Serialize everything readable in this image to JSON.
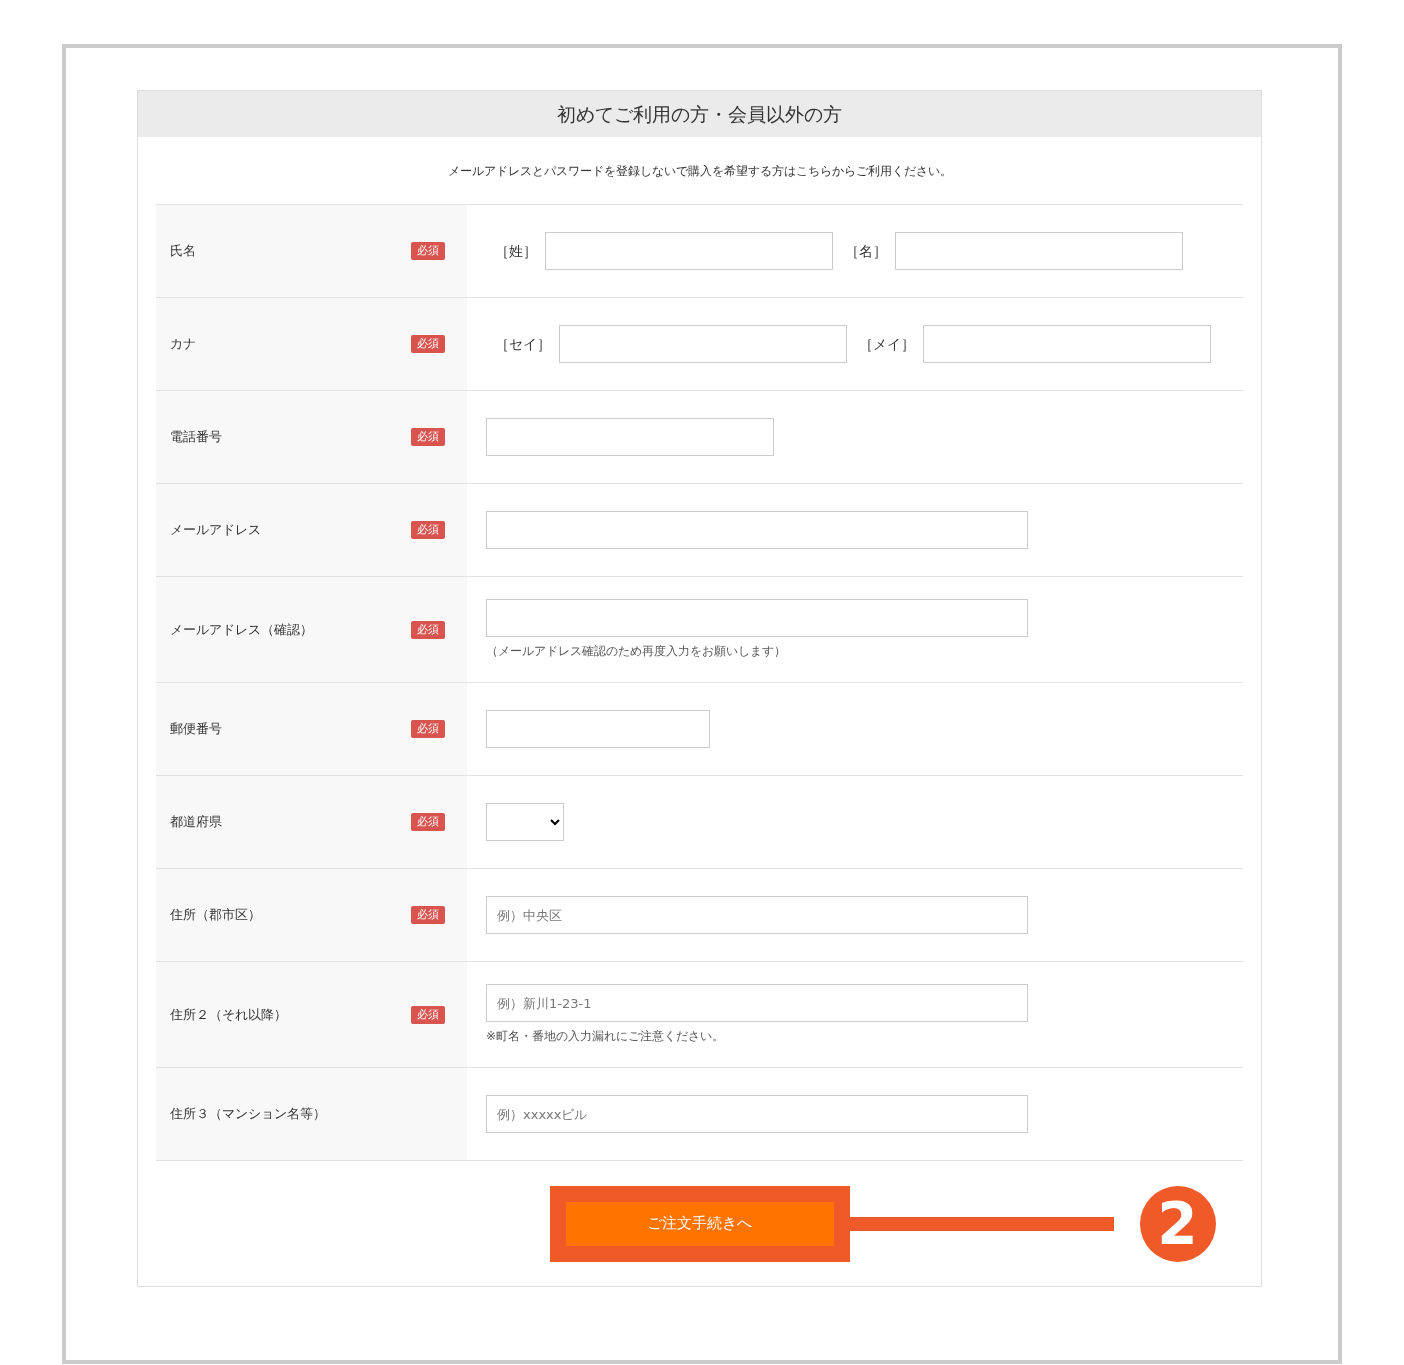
{
  "section": {
    "title": "初めてご利用の方・会員以外の方",
    "intro": "メールアドレスとパスワードを登録しないで購入を希望する方はこちらからご利用ください。"
  },
  "rows": [
    {
      "label": "氏名",
      "badge": "必須",
      "kind": "pair",
      "fields": [
        {
          "prefix": "［姓］"
        },
        {
          "prefix": "［名］"
        }
      ]
    },
    {
      "label": "カナ",
      "badge": "必須",
      "kind": "pair",
      "fields": [
        {
          "prefix": "［セイ］"
        },
        {
          "prefix": "［メイ］"
        }
      ]
    },
    {
      "label": "電話番号",
      "badge": "必須",
      "kind": "tel"
    },
    {
      "label": "メールアドレス",
      "badge": "必須",
      "kind": "email"
    },
    {
      "label": "メールアドレス（確認）",
      "badge": "必須",
      "kind": "email",
      "note": "（メールアドレス確認のため再度入力をお願いします）"
    },
    {
      "label": "郵便番号",
      "badge": "必須",
      "kind": "zip"
    },
    {
      "label": "都道府県",
      "badge": "必須",
      "kind": "select"
    },
    {
      "label": "住所（郡市区）",
      "badge": "必須",
      "kind": "text",
      "placeholder": "例）中央区"
    },
    {
      "label": "住所２（それ以降）",
      "badge": "必須",
      "kind": "text",
      "placeholder": "例）新川1-23-1",
      "note": "※町名・番地の入力漏れにご注意ください。"
    },
    {
      "label": "住所３（マンション名等）",
      "kind": "text",
      "placeholder": "例）xxxxxビル"
    }
  ],
  "submit_button": {
    "label": "ご注文手続きへ"
  },
  "callout": {
    "number": "2"
  }
}
